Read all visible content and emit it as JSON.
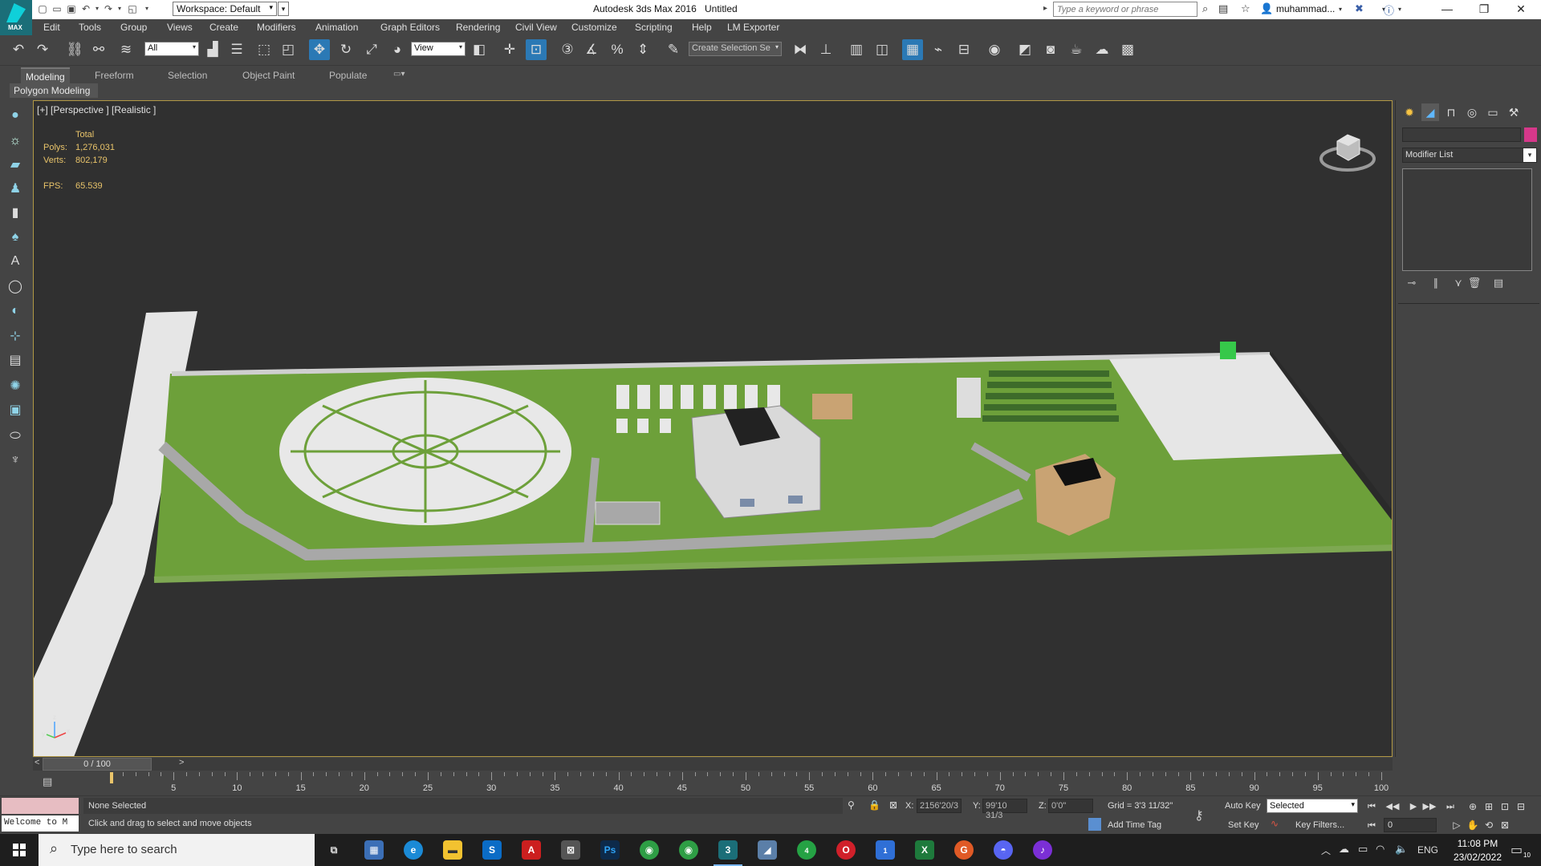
{
  "titlebar": {
    "app_title": "Autodesk 3ds Max 2016",
    "document": "Untitled",
    "workspace": "Workspace: Default",
    "search_placeholder": "Type a keyword or phrase",
    "user": "muhammad...",
    "logo_text": "MAX"
  },
  "menu": [
    "Edit",
    "Tools",
    "Group",
    "Views",
    "Create",
    "Modifiers",
    "Animation",
    "Graph Editors",
    "Rendering",
    "Civil View",
    "Customize",
    "Scripting",
    "Help",
    "LM Exporter"
  ],
  "toolbar": {
    "selection_filter": "All",
    "reference_coord": "View",
    "named_selection_placeholder": "Create Selection Se"
  },
  "ribbon": {
    "tabs": [
      "Modeling",
      "Freeform",
      "Selection",
      "Object Paint",
      "Populate"
    ],
    "active_tab": "Modeling",
    "sub_label": "Polygon Modeling"
  },
  "viewport": {
    "label": "[+] [Perspective ] [Realistic ]",
    "stats": {
      "header": "Total",
      "polys_label": "Polys:",
      "polys": "1,276,031",
      "verts_label": "Verts:",
      "verts": "802,179",
      "fps_label": "FPS:",
      "fps": "65.539"
    },
    "axis": {
      "x": "x",
      "y": "y",
      "z": "z"
    }
  },
  "command_panel": {
    "modifier_list": "Modifier List",
    "object_color": "#d6388a"
  },
  "timeline": {
    "current": "0 / 100",
    "ticks": [
      0,
      5,
      10,
      15,
      20,
      25,
      30,
      35,
      40,
      45,
      50,
      55,
      60,
      65,
      70,
      75,
      80,
      85,
      90,
      95,
      100
    ]
  },
  "status": {
    "listener_text": "Welcome to M",
    "selection": "None Selected",
    "prompt": "Click and drag to select and move objects",
    "x_label": "X:",
    "x_value": "2156'20/3",
    "y_label": "Y:",
    "y_value": "99'10 31/3",
    "z_label": "Z:",
    "z_value": "0'0\"",
    "grid": "Grid = 3'3 11/32\"",
    "add_time_tag": "Add Time Tag",
    "auto_key": "Auto Key",
    "set_key": "Set Key",
    "key_mode": "Selected",
    "key_filters": "Key Filters...",
    "frame": "0"
  },
  "taskbar": {
    "search_placeholder": "Type here to search",
    "language": "ENG",
    "time": "11:08 PM",
    "date": "23/02/2022",
    "notifications": "10",
    "whatsapp_badge": "4",
    "todo_badge": "1"
  },
  "colors": {
    "accent": "#2b79b5",
    "viewport_border": "#b19845",
    "stats_text": "#e9c46a",
    "grass": "#6da03a"
  }
}
